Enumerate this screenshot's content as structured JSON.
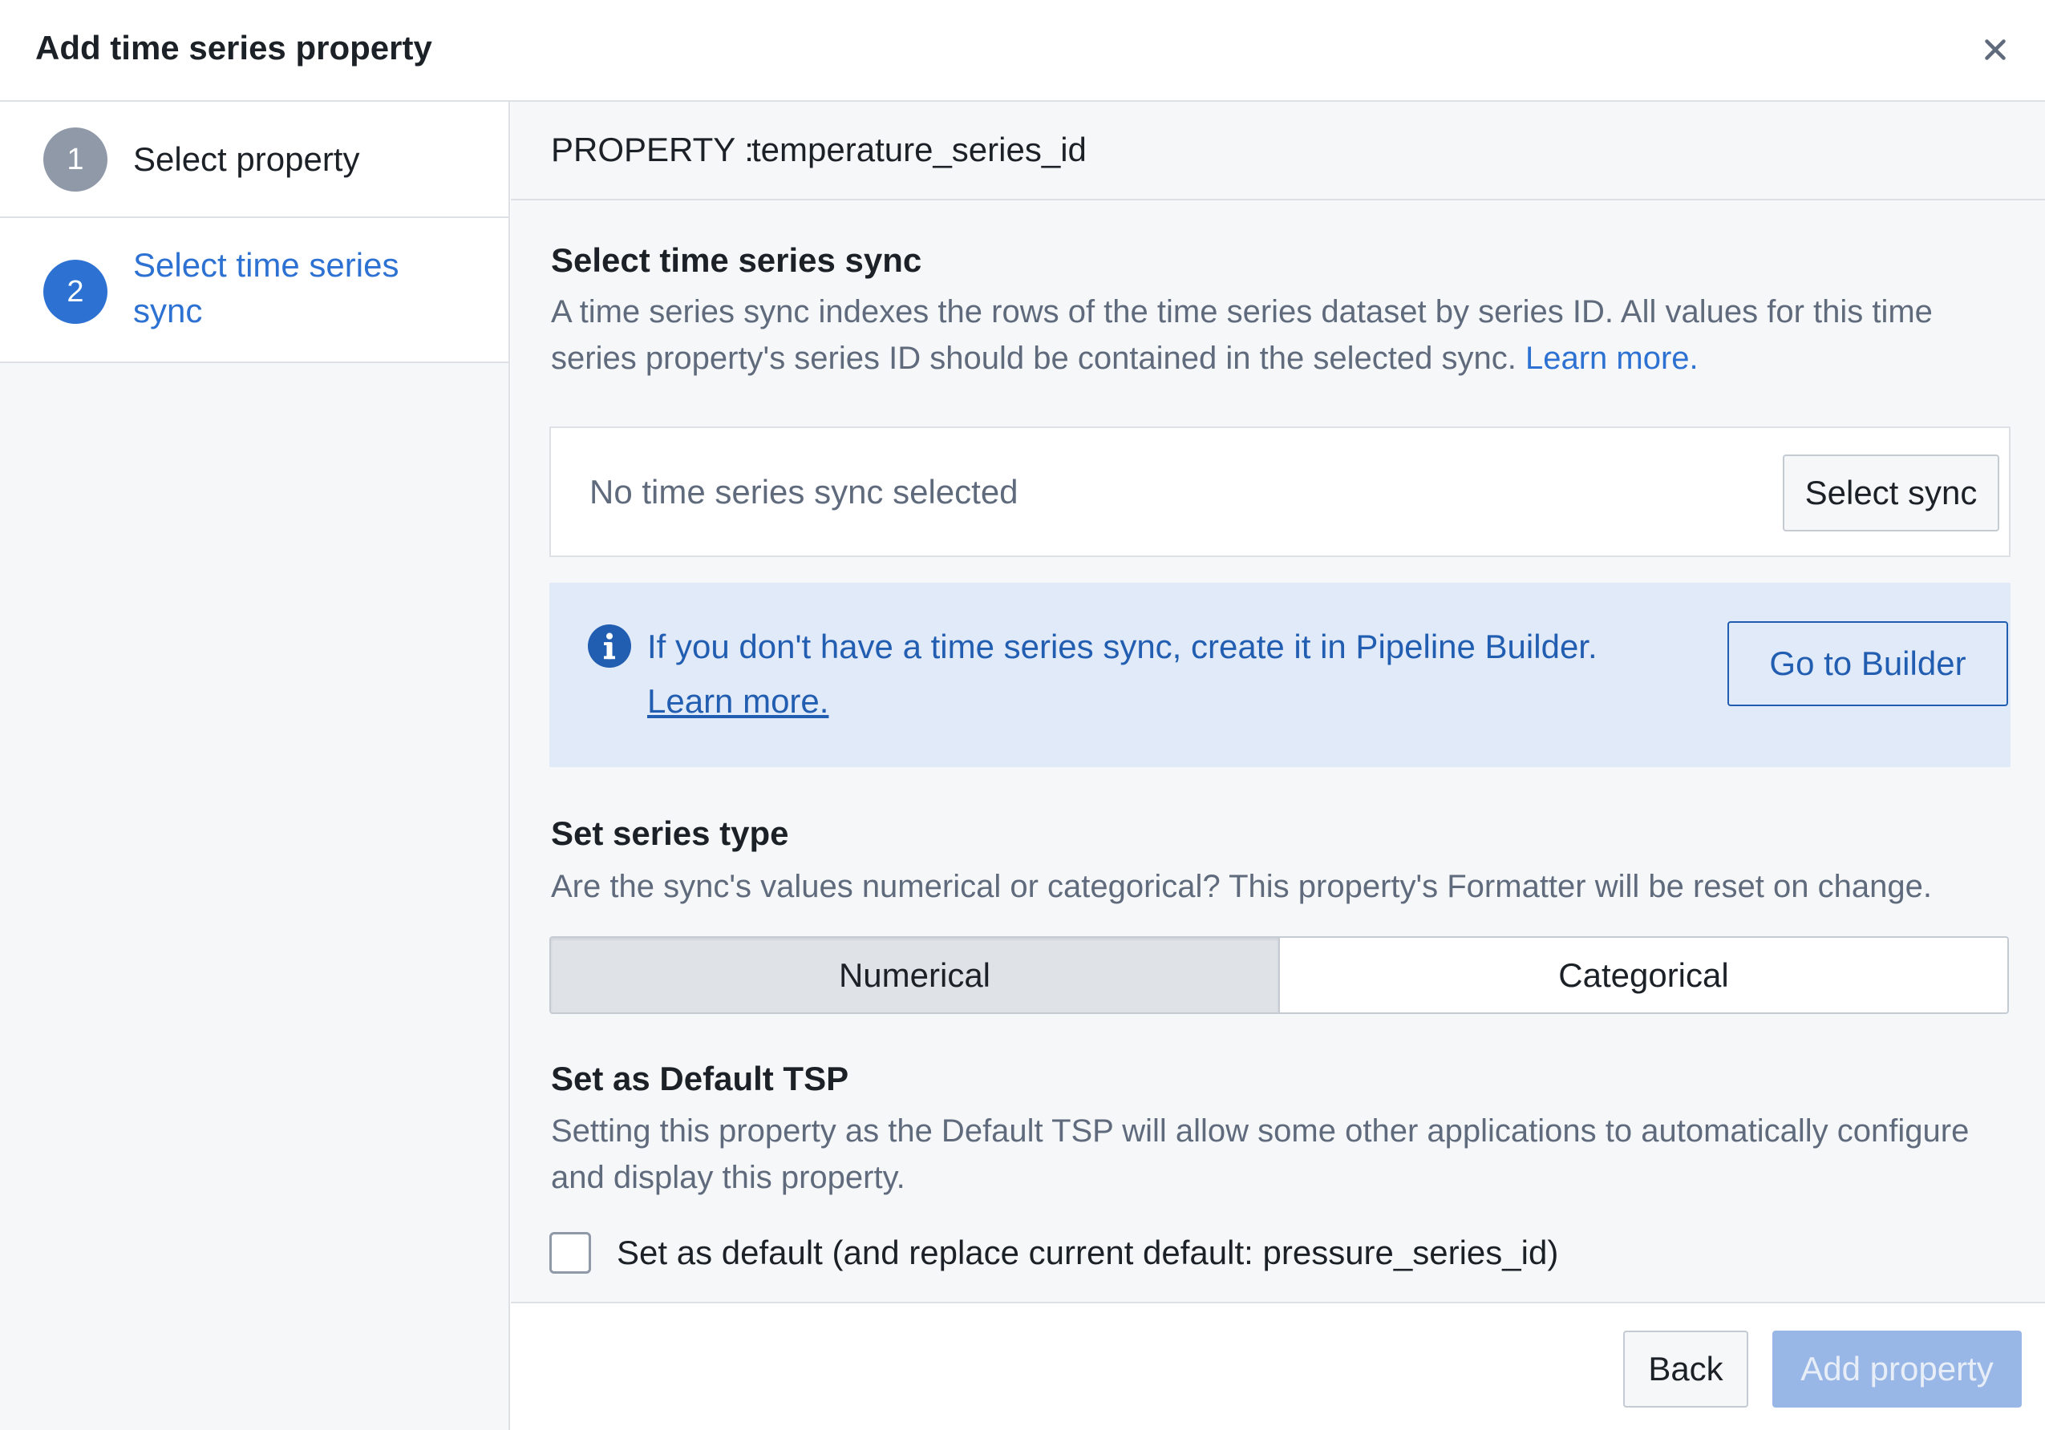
{
  "dialog": {
    "title": "Add time series property",
    "close_icon": "close-icon"
  },
  "steps": [
    {
      "number": "1",
      "label": "Select property",
      "state": "complete"
    },
    {
      "number": "2",
      "label": "Select time series sync",
      "state": "active"
    }
  ],
  "property": {
    "key": "PROPERTY :",
    "value": "temperature_series_id"
  },
  "sync_section": {
    "title": "Select time series sync",
    "description": "A time series sync indexes the rows of the time series dataset by series ID. All values for this time series property's series ID should be contained in the selected sync.",
    "learn_more": "Learn more.",
    "empty_text": "No time series sync selected",
    "select_button": "Select sync"
  },
  "callout": {
    "icon": "info-icon",
    "text": "If you don't have a time series sync, create it in Pipeline Builder.",
    "link": "Learn more.",
    "button": "Go to Builder"
  },
  "series_type": {
    "title": "Set series type",
    "description": "Are the sync's values numerical or categorical? This property's Formatter will be reset on change.",
    "options": [
      "Numerical",
      "Categorical"
    ],
    "selected": "Numerical"
  },
  "default_tsp": {
    "title": "Set as Default TSP",
    "description": "Setting this property as the Default TSP will allow some other applications to automatically configure and display this property.",
    "checkbox_label": "Set as default (and replace current default: pressure_series_id)",
    "checked": false
  },
  "footer": {
    "back": "Back",
    "add": "Add property"
  },
  "colors": {
    "accent": "#2d72d2",
    "callout_bg": "#e1eaf8",
    "callout_text": "#215db0",
    "step_complete": "#8f99a8",
    "disabled_primary": "#99b7e6"
  }
}
